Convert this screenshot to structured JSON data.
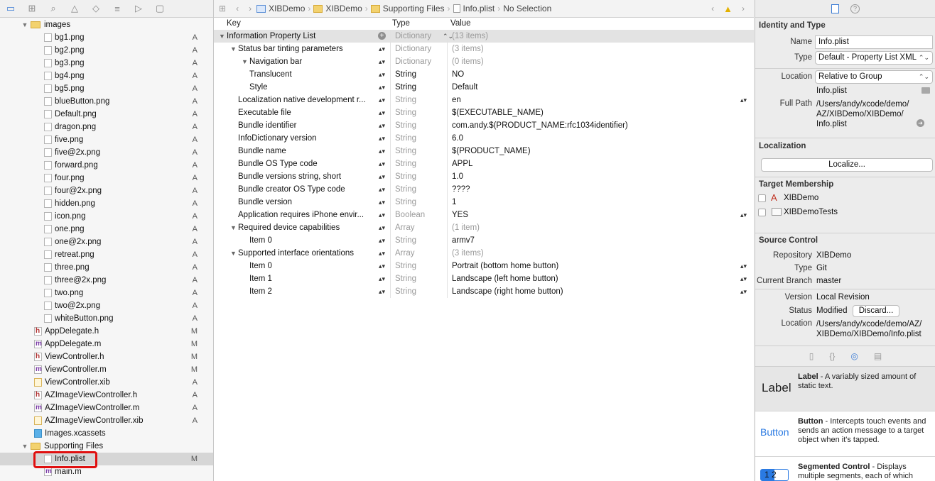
{
  "navigator": {
    "files": [
      {
        "name": "images",
        "kind": "folder",
        "indent": 0,
        "disclosure": "▼",
        "status": ""
      },
      {
        "name": "bg1.png",
        "kind": "file",
        "indent": 2,
        "status": "A"
      },
      {
        "name": "bg2.png",
        "kind": "file",
        "indent": 2,
        "status": "A"
      },
      {
        "name": "bg3.png",
        "kind": "file",
        "indent": 2,
        "status": "A"
      },
      {
        "name": "bg4.png",
        "kind": "file",
        "indent": 2,
        "status": "A"
      },
      {
        "name": "bg5.png",
        "kind": "file",
        "indent": 2,
        "status": "A"
      },
      {
        "name": "blueButton.png",
        "kind": "file",
        "indent": 2,
        "status": "A"
      },
      {
        "name": "Default.png",
        "kind": "file",
        "indent": 2,
        "status": "A"
      },
      {
        "name": "dragon.png",
        "kind": "file",
        "indent": 2,
        "status": "A"
      },
      {
        "name": "five.png",
        "kind": "file",
        "indent": 2,
        "status": "A"
      },
      {
        "name": "five@2x.png",
        "kind": "file",
        "indent": 2,
        "status": "A"
      },
      {
        "name": "forward.png",
        "kind": "file",
        "indent": 2,
        "status": "A"
      },
      {
        "name": "four.png",
        "kind": "file",
        "indent": 2,
        "status": "A"
      },
      {
        "name": "four@2x.png",
        "kind": "file",
        "indent": 2,
        "status": "A"
      },
      {
        "name": "hidden.png",
        "kind": "file",
        "indent": 2,
        "status": "A"
      },
      {
        "name": "icon.png",
        "kind": "file",
        "indent": 2,
        "status": "A"
      },
      {
        "name": "one.png",
        "kind": "file",
        "indent": 2,
        "status": "A"
      },
      {
        "name": "one@2x.png",
        "kind": "file",
        "indent": 2,
        "status": "A"
      },
      {
        "name": "retreat.png",
        "kind": "file",
        "indent": 2,
        "status": "A"
      },
      {
        "name": "three.png",
        "kind": "file",
        "indent": 2,
        "status": "A"
      },
      {
        "name": "three@2x.png",
        "kind": "file",
        "indent": 2,
        "status": "A"
      },
      {
        "name": "two.png",
        "kind": "file",
        "indent": 2,
        "status": "A"
      },
      {
        "name": "two@2x.png",
        "kind": "file",
        "indent": 2,
        "status": "A"
      },
      {
        "name": "whiteButton.png",
        "kind": "file",
        "indent": 2,
        "status": "A"
      },
      {
        "name": "AppDelegate.h",
        "kind": "h",
        "indent": 1,
        "status": "M"
      },
      {
        "name": "AppDelegate.m",
        "kind": "m",
        "indent": 1,
        "status": "M"
      },
      {
        "name": "ViewController.h",
        "kind": "h",
        "indent": 1,
        "status": "M"
      },
      {
        "name": "ViewController.m",
        "kind": "m",
        "indent": 1,
        "status": "M"
      },
      {
        "name": "ViewController.xib",
        "kind": "xib",
        "indent": 1,
        "status": "A"
      },
      {
        "name": "AZImageViewController.h",
        "kind": "h",
        "indent": 1,
        "status": "A"
      },
      {
        "name": "AZImageViewController.m",
        "kind": "m",
        "indent": 1,
        "status": "A"
      },
      {
        "name": "AZImageViewController.xib",
        "kind": "xib",
        "indent": 1,
        "status": "A"
      },
      {
        "name": "Images.xcassets",
        "kind": "assets",
        "indent": 1,
        "status": ""
      },
      {
        "name": "Supporting Files",
        "kind": "folder",
        "indent": 0,
        "disclosure": "▼",
        "status": ""
      },
      {
        "name": "Info.plist",
        "kind": "file",
        "indent": 2,
        "status": "M",
        "selected": true
      },
      {
        "name": "main.m",
        "kind": "m",
        "indent": 2,
        "status": ""
      }
    ]
  },
  "jumpbar": {
    "crumbs": [
      {
        "label": "XIBDemo",
        "icon": "proj"
      },
      {
        "label": "XIBDemo",
        "icon": "folder"
      },
      {
        "label": "Supporting Files",
        "icon": "folder"
      },
      {
        "label": "Info.plist",
        "icon": "file"
      },
      {
        "label": "No Selection",
        "icon": ""
      }
    ]
  },
  "plist": {
    "headers": {
      "key": "Key",
      "type": "Type",
      "value": "Value"
    },
    "rows": [
      {
        "key": "Information Property List",
        "level": 0,
        "disc": "▼",
        "type": "Dictionary",
        "value": "(13 items)",
        "type_dim": true,
        "value_dim": true,
        "add": true,
        "type_step": true
      },
      {
        "key": "Status bar tinting parameters",
        "level": 1,
        "disc": "▼",
        "type": "Dictionary",
        "value": "(3 items)",
        "type_dim": true,
        "value_dim": true,
        "step": true
      },
      {
        "key": "Navigation bar",
        "level": 2,
        "disc": "▼",
        "type": "Dictionary",
        "value": "(0 items)",
        "type_dim": true,
        "value_dim": true,
        "step": true
      },
      {
        "key": "Translucent",
        "level": 3,
        "type": "String",
        "value": "NO",
        "step": true
      },
      {
        "key": "Style",
        "level": 3,
        "type": "String",
        "value": "Default",
        "step": true
      },
      {
        "key": "Localization native development r...",
        "level": 1,
        "type": "String",
        "value": "en",
        "type_dim": true,
        "step": true,
        "vstep": true
      },
      {
        "key": "Executable file",
        "level": 1,
        "type": "String",
        "value": "$(EXECUTABLE_NAME)",
        "type_dim": true,
        "step": true
      },
      {
        "key": "Bundle identifier",
        "level": 1,
        "type": "String",
        "value": "com.andy.$(PRODUCT_NAME:rfc1034identifier)",
        "type_dim": true,
        "step": true
      },
      {
        "key": "InfoDictionary version",
        "level": 1,
        "type": "String",
        "value": "6.0",
        "type_dim": true,
        "step": true
      },
      {
        "key": "Bundle name",
        "level": 1,
        "type": "String",
        "value": "$(PRODUCT_NAME)",
        "type_dim": true,
        "step": true
      },
      {
        "key": "Bundle OS Type code",
        "level": 1,
        "type": "String",
        "value": "APPL",
        "type_dim": true,
        "step": true
      },
      {
        "key": "Bundle versions string, short",
        "level": 1,
        "type": "String",
        "value": "1.0",
        "type_dim": true,
        "step": true
      },
      {
        "key": "Bundle creator OS Type code",
        "level": 1,
        "type": "String",
        "value": "????",
        "type_dim": true,
        "step": true
      },
      {
        "key": "Bundle version",
        "level": 1,
        "type": "String",
        "value": "1",
        "type_dim": true,
        "step": true
      },
      {
        "key": "Application requires iPhone envir...",
        "level": 1,
        "type": "Boolean",
        "value": "YES",
        "type_dim": true,
        "step": true,
        "vstep": true
      },
      {
        "key": "Required device capabilities",
        "level": 1,
        "disc": "▼",
        "type": "Array",
        "value": "(1 item)",
        "type_dim": true,
        "value_dim": true,
        "step": true
      },
      {
        "key": "Item 0",
        "level": 2,
        "type": "String",
        "value": "armv7",
        "type_dim": true,
        "step": true
      },
      {
        "key": "Supported interface orientations",
        "level": 1,
        "disc": "▼",
        "type": "Array",
        "value": "(3 items)",
        "type_dim": true,
        "value_dim": true,
        "step": true
      },
      {
        "key": "Item 0",
        "level": 2,
        "type": "String",
        "value": "Portrait (bottom home button)",
        "type_dim": true,
        "step": true,
        "vstep": true
      },
      {
        "key": "Item 1",
        "level": 2,
        "type": "String",
        "value": "Landscape (left home button)",
        "type_dim": true,
        "step": true,
        "vstep": true
      },
      {
        "key": "Item 2",
        "level": 2,
        "type": "String",
        "value": "Landscape (right home button)",
        "type_dim": true,
        "step": true,
        "vstep": true
      }
    ]
  },
  "inspector": {
    "identity": {
      "title": "Identity and Type",
      "name_label": "Name",
      "name_value": "Info.plist",
      "type_label": "Type",
      "type_value": "Default - Property List XML",
      "location_label": "Location",
      "location_value": "Relative to Group",
      "location_file": "Info.plist",
      "fullpath_label": "Full Path",
      "fullpath_value": "/Users/andy/xcode/demo/\nAZ/XIBDemo/XIBDemo/\nInfo.plist"
    },
    "localization": {
      "title": "Localization",
      "button": "Localize..."
    },
    "membership": {
      "title": "Target Membership",
      "targets": [
        "XIBDemo",
        "XIBDemoTests"
      ]
    },
    "source_control": {
      "title": "Source Control",
      "repository_label": "Repository",
      "repository_value": "XIBDemo",
      "type_label": "Type",
      "type_value": "Git",
      "branch_label": "Current Branch",
      "branch_value": "master",
      "version_label": "Version",
      "version_value": "Local Revision",
      "status_label": "Status",
      "status_value": "Modified",
      "discard": "Discard...",
      "location_label": "Location",
      "location_value": "/Users/andy/xcode/demo/AZ/\nXIBDemo/XIBDemo/Info.plist"
    },
    "library": [
      {
        "preview": "Label",
        "title": "Label",
        "desc": " - A variably sized amount of static text."
      },
      {
        "preview": "Button",
        "title": "Button",
        "desc": " - Intercepts touch events and sends an action message to a target object when it's tapped."
      },
      {
        "preview": "1 2",
        "title": "Segmented Control",
        "desc": " - Displays multiple segments, each of which"
      }
    ]
  }
}
